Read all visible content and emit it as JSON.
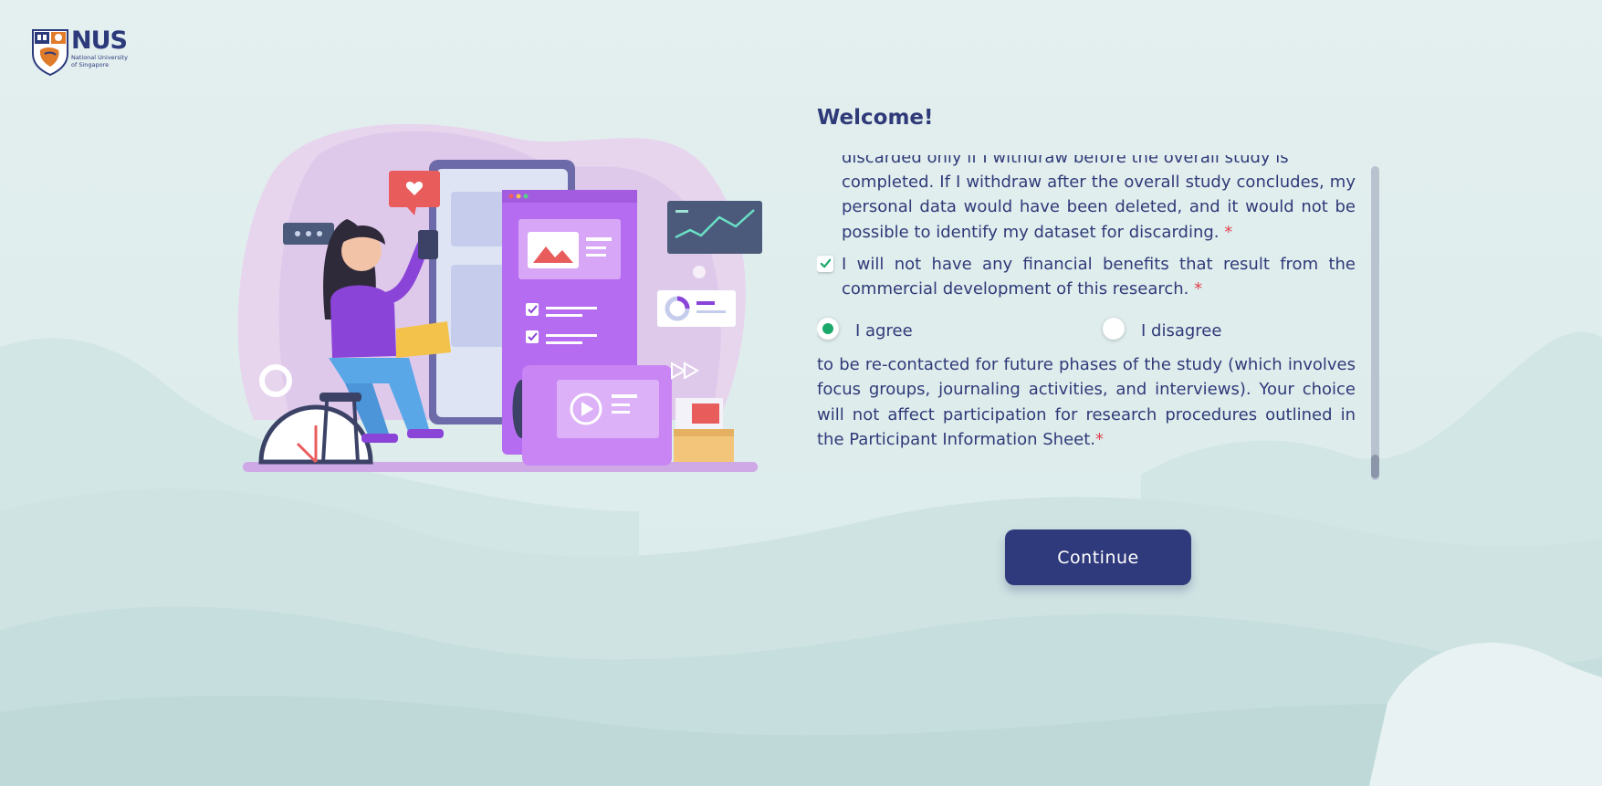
{
  "logo": {
    "name": "NUS",
    "subtitle_line1": "National University",
    "subtitle_line2": "of Singapore"
  },
  "welcome_title": "Welcome!",
  "consent": {
    "partial_line": "discarded only if I withdraw before the overall study is",
    "withdraw_text": "completed. If I withdraw after the overall study concludes, my personal data would have been deleted, and it would not be possible to identify my dataset for discarding.",
    "financial_item": {
      "checked": true,
      "text": "I will not have any financial benefits that result from the commercial development of this research."
    },
    "required_marker": "*",
    "recontact": {
      "options": [
        {
          "label": "I agree",
          "selected": true
        },
        {
          "label": "I disagree",
          "selected": false
        }
      ],
      "text": "to be re-contacted for future phases of the study (which involves focus groups, journaling activities, and interviews). Your choice will not affect participation for research procedures outlined in the Participant Information Sheet."
    }
  },
  "continue_label": "Continue",
  "colors": {
    "primary": "#2f3a7c",
    "required": "#e0434f",
    "radio_selected": "#1aa86b",
    "background": "#e2eeee"
  },
  "icons": {
    "checkbox": "check-icon",
    "logo": "nus-shield-icon"
  }
}
